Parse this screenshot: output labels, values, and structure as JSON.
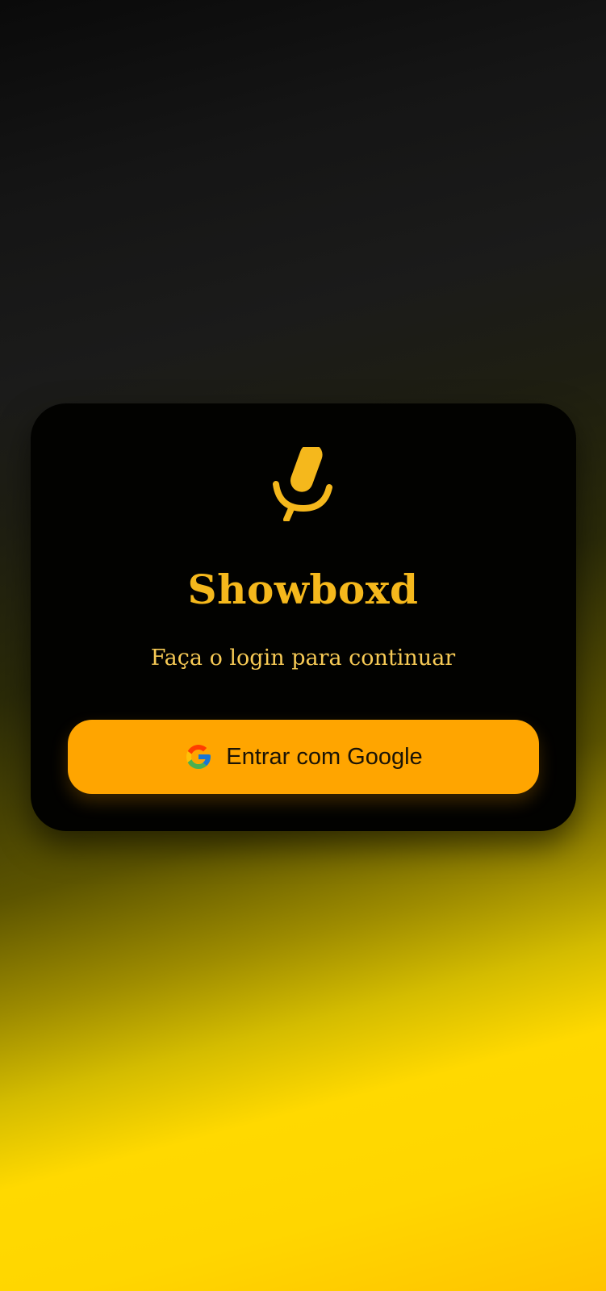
{
  "app": {
    "title": "Showboxd",
    "subtitle": "Faça o login para continuar",
    "logo_icon": "microphone-icon"
  },
  "login": {
    "google_button_label": "Entrar com Google",
    "google_icon": "google-icon"
  },
  "colors": {
    "accent": "#f5b81c",
    "subtitle": "#f7ca55",
    "button": "#ffa500",
    "card": "#020200",
    "background_top": "#0a0a0a",
    "background_bottom": "#ffd600"
  }
}
